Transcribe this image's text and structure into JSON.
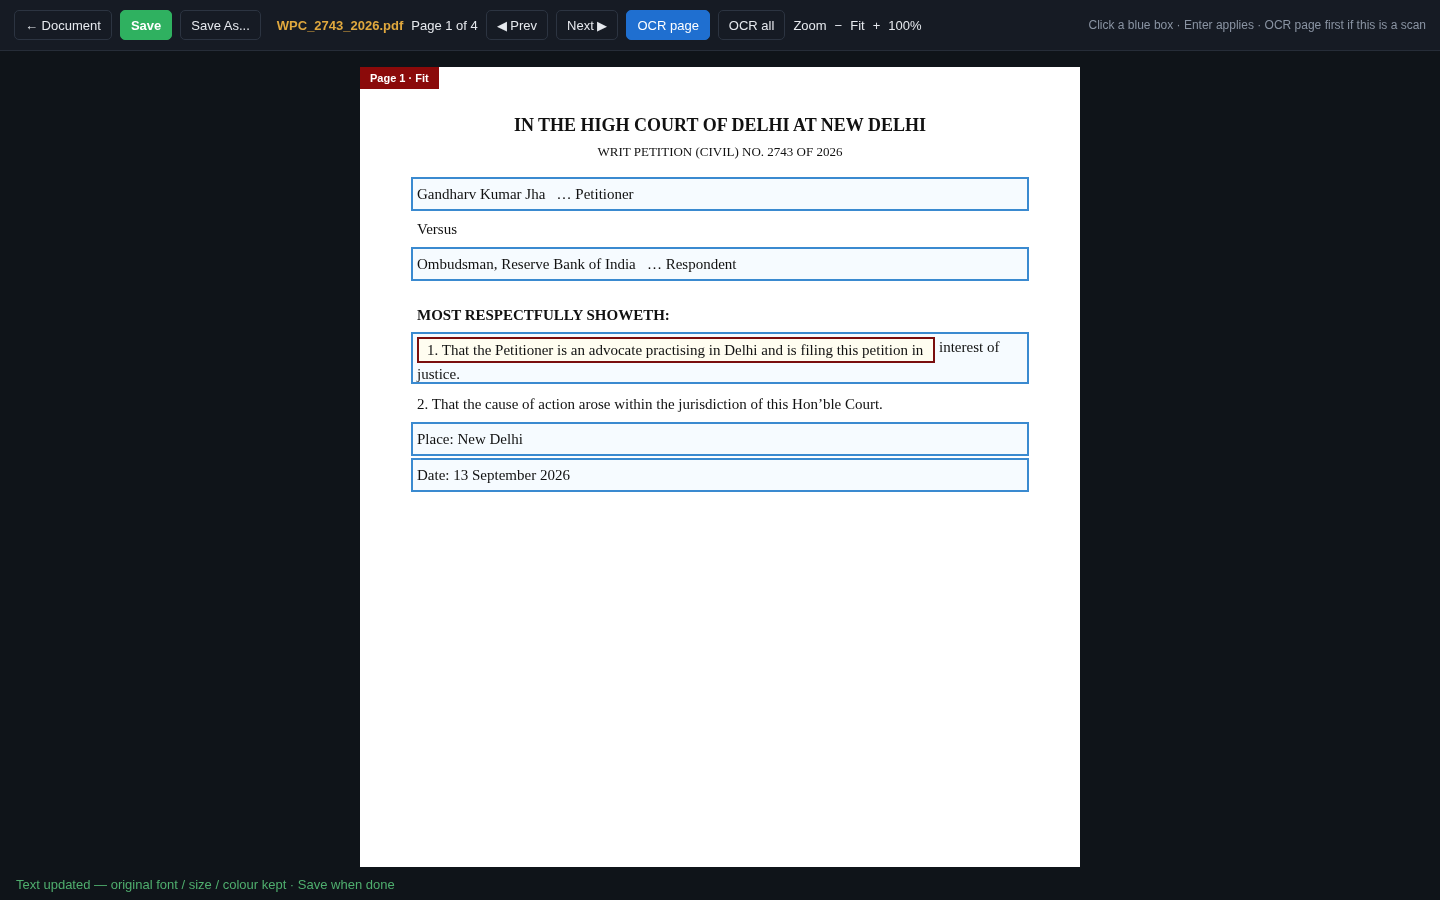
{
  "toolbar": {
    "items": [
      {
        "kind": "button",
        "label": "← Document"
      },
      {
        "kind": "save",
        "label": "Save"
      },
      {
        "kind": "button",
        "label": "Save As..."
      },
      {
        "kind": "filename",
        "label": "WPC_2743_2026.pdf"
      },
      {
        "kind": "text",
        "label": "Page 1 of 4"
      },
      {
        "kind": "button",
        "label": "◀ Prev"
      },
      {
        "kind": "button",
        "label": "Next ▶"
      },
      {
        "kind": "toggle",
        "label": "OCR page",
        "selected": true
      },
      {
        "kind": "toggle",
        "label": "OCR all",
        "selected": false
      },
      {
        "kind": "text",
        "label": "Zoom"
      },
      {
        "kind": "link",
        "label": "−"
      },
      {
        "kind": "link",
        "label": "Fit"
      },
      {
        "kind": "link",
        "label": "+"
      },
      {
        "kind": "text",
        "label": "100%"
      }
    ],
    "hint": "Click a blue box · Enter applies · OCR page first if this is a scan"
  },
  "page": {
    "badge": "Page 1 · Fit",
    "title": "IN THE HIGH COURT OF DELHI AT NEW DELHI",
    "subtitle": "WRIT PETITION (CIVIL) NO. 2743 OF 2026",
    "blocks": [
      {
        "kind": "box",
        "text": "Gandharv Kumar Jha   … Petitioner"
      },
      {
        "kind": "plain",
        "text": "Versus"
      },
      {
        "kind": "box",
        "text": "Ombudsman, Reserve Bank of India   … Respondent"
      },
      {
        "kind": "heading",
        "text": "MOST RESPECTFULLY SHOWETH:"
      },
      {
        "kind": "editing",
        "line_end": "interest of",
        "next_line": "justice.",
        "editor_value": "1. That the Petitioner is an advocate practising in Delhi and is filing this petition in"
      },
      {
        "kind": "plain",
        "text": "2. That the cause of action arose within the jurisdiction of this Hon’ble Court."
      },
      {
        "kind": "box",
        "text": "Place: New Delhi"
      },
      {
        "kind": "box",
        "text": "Date: 13 September 2026"
      }
    ]
  },
  "status": "Text updated — original font / size / colour kept · Save when done"
}
